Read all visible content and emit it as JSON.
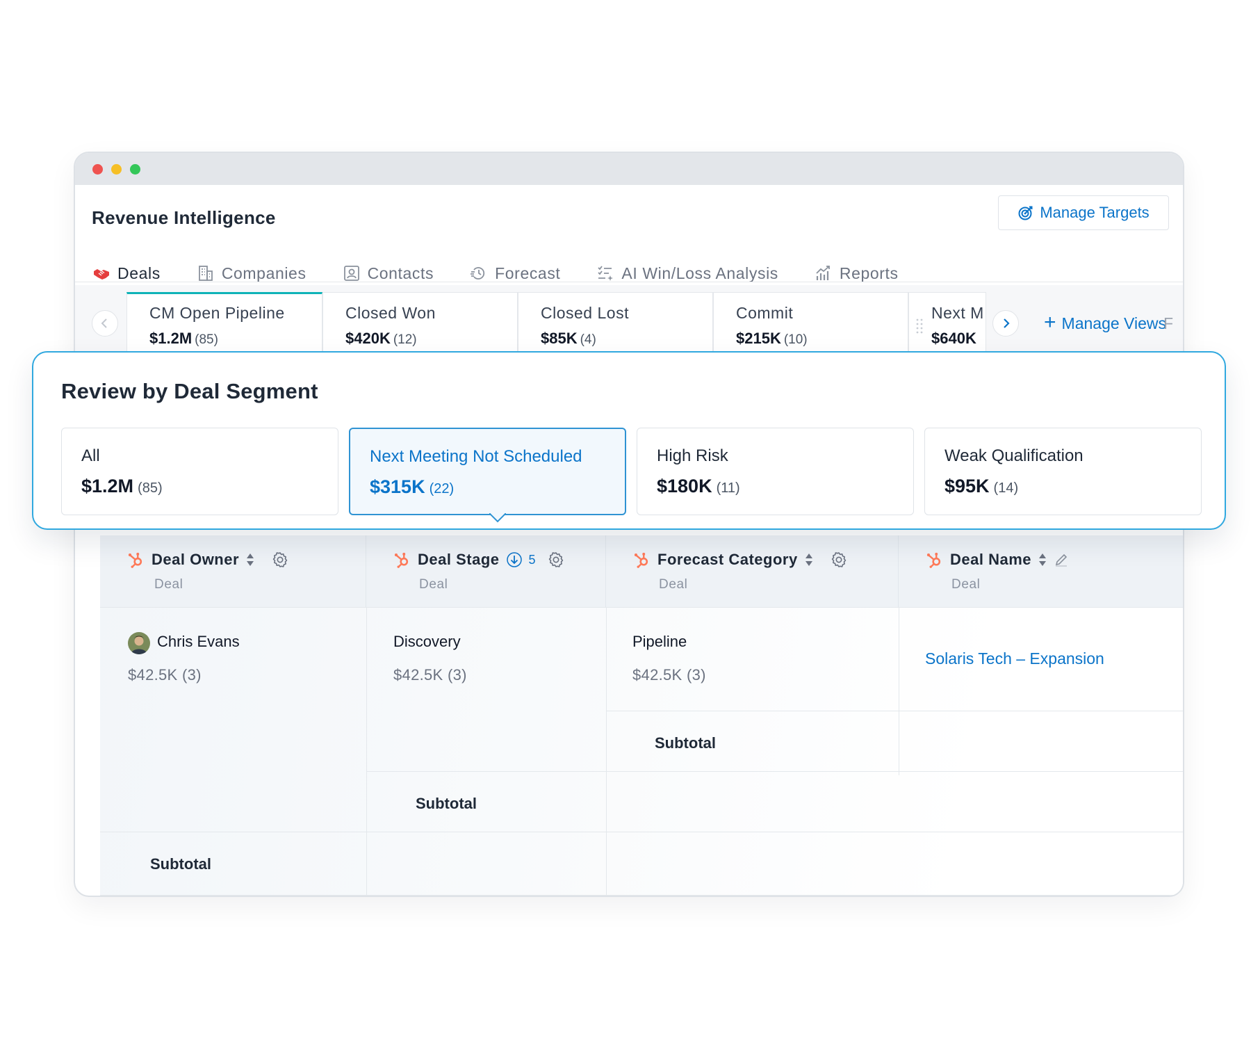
{
  "app": {
    "title": "Revenue Intelligence",
    "manage_targets_label": "Manage Targets"
  },
  "tabs": [
    {
      "label": "Deals",
      "icon": "handshake-icon",
      "active": true
    },
    {
      "label": "Companies",
      "icon": "building-icon"
    },
    {
      "label": "Contacts",
      "icon": "contact-card-icon"
    },
    {
      "label": "Forecast",
      "icon": "forecast-history-icon"
    },
    {
      "label": "AI Win/Loss Analysis",
      "icon": "ai-list-icon"
    },
    {
      "label": "Reports",
      "icon": "chart-growth-icon"
    }
  ],
  "views": [
    {
      "name": "CM Open Pipeline",
      "value": "$1.2M",
      "count": "(85)",
      "active": true
    },
    {
      "name": "Closed Won",
      "value": "$420K",
      "count": "(12)"
    },
    {
      "name": "Closed Lost",
      "value": "$85K",
      "count": "(4)"
    },
    {
      "name": "Commit",
      "value": "$215K",
      "count": "(10)"
    },
    {
      "name": "Next M",
      "value": "$640K",
      "count": ""
    }
  ],
  "manage_views_label": "Manage Views",
  "manage_views_overflow": "F",
  "segment": {
    "title": "Review by Deal Segment",
    "cards": [
      {
        "name": "All",
        "value": "$1.2M",
        "count": "(85)"
      },
      {
        "name": "Next Meeting Not Scheduled",
        "value": "$315K",
        "count": "(22)",
        "active": true
      },
      {
        "name": "High Risk",
        "value": "$180K",
        "count": "(11)"
      },
      {
        "name": "Weak Qualification",
        "value": "$95K",
        "count": "(14)"
      }
    ]
  },
  "table": {
    "columns": [
      {
        "title": "Deal Owner",
        "sub": "Deal"
      },
      {
        "title": "Deal Stage",
        "sub": "Deal",
        "sort_count": "5"
      },
      {
        "title": "Forecast Category",
        "sub": "Deal"
      },
      {
        "title": "Deal Name",
        "sub": "Deal"
      }
    ],
    "owner": {
      "name": "Chris Evans",
      "summary": "$42.5K (3)"
    },
    "stage": {
      "name": "Discovery",
      "summary": "$42.5K (3)"
    },
    "forecast": {
      "name": "Pipeline",
      "summary": "$42.5K (3)"
    },
    "deal_name": "Solaris Tech – Expansion",
    "subtotal_label": "Subtotal"
  },
  "colors": {
    "accent_blue": "#0b74c9",
    "active_tab_red": "#e53e3e",
    "active_view_teal": "#0fb3b8",
    "overlay_border": "#30a8df",
    "hubspot_orange": "#ff7a59"
  }
}
